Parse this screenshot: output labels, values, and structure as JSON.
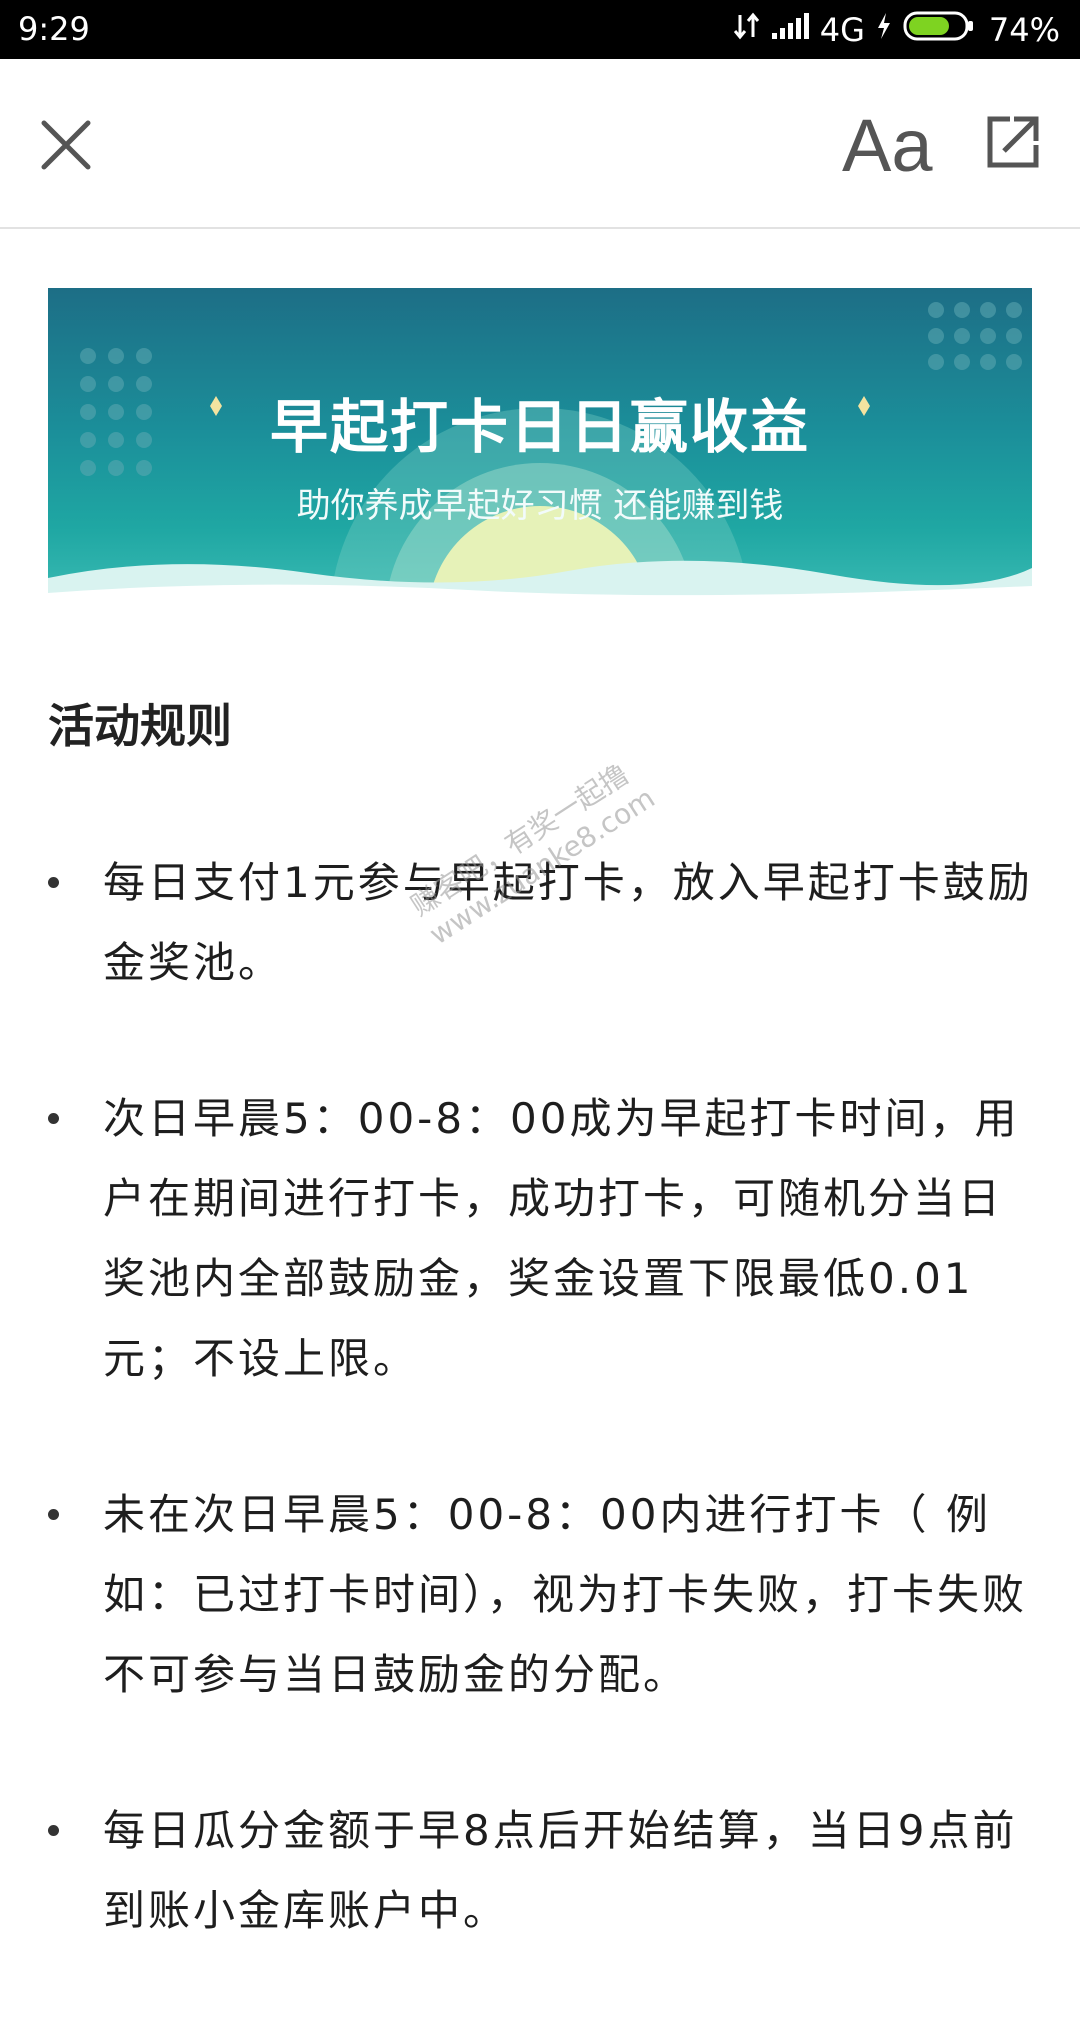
{
  "status_bar": {
    "time": "9:29",
    "network": "4G",
    "battery": "74%",
    "battery_level": 0.74
  },
  "toolbar": {
    "font_button_label": "Aa"
  },
  "banner": {
    "title": "早起打卡日日赢收益",
    "subtitle": "助你养成早起好习惯 还能赚到钱"
  },
  "section_heading": "活动规则",
  "rules": [
    "每日支付1元参与早起打卡，放入早起打卡鼓励金奖池。",
    "次日早晨5：00-8：00成为早起打卡时间，用户在期间进行打卡，成功打卡，可随机分当日奖池内全部鼓励金，奖金设置下限最低0.01元；不设上限。",
    "未在次日早晨5：00-8：00内进行打卡（ 例如：已过打卡时间），视为打卡失败，打卡失败不可参与当日鼓励金的分配。",
    "每日瓜分金额于早8点后开始结算，当日9点前到账小金库账户中。"
  ],
  "watermark": {
    "line1": "赚客吧，有奖一起撸",
    "line2": "www.zuanke8.com"
  },
  "colors": {
    "banner_top": "#1d6e86",
    "banner_bottom": "#3cbcb4",
    "battery_green": "#7ed321"
  }
}
